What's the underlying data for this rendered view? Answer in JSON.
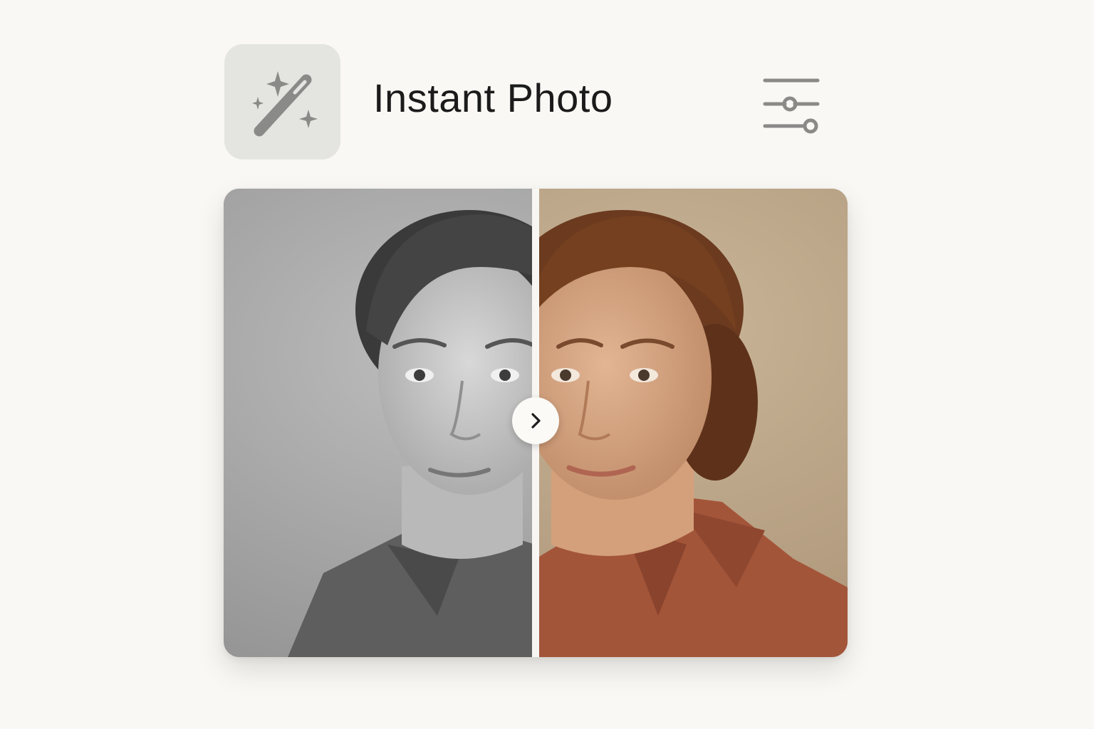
{
  "header": {
    "app_title": "Instant Photo",
    "app_icon": "magic-wand-icon",
    "settings_icon": "sliders-icon"
  },
  "compare": {
    "before_label": "before-photo-black-and-white",
    "after_label": "after-photo-colorized",
    "handle_icon": "chevron-right-icon",
    "split_position": 0.5
  },
  "colors": {
    "page_background": "#f9f8f4",
    "icon_tile": "#e4e4e1",
    "icon_gray": "#8a8a88",
    "title_text": "#1b1b1b",
    "divider": "#f7f6f2"
  }
}
